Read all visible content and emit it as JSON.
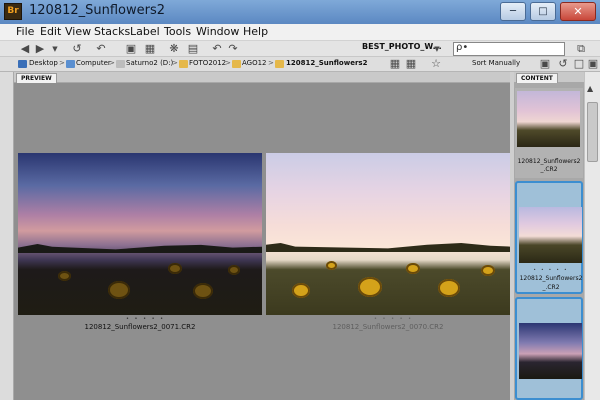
{
  "window": {
    "app_icon": "Br",
    "title": "120812_Sunflowers2",
    "min_icon": "minimize-icon",
    "max_icon": "maximize-icon",
    "close_icon": "close-icon"
  },
  "menu": [
    "File",
    "Edit",
    "View",
    "Stacks",
    "Label",
    "Tools",
    "Window",
    "Help"
  ],
  "toolbar": {
    "workspace_label": "BEST_PHOTO_W...",
    "search_placeholder": "ρ•"
  },
  "path": {
    "crumbs": [
      {
        "label": "Desktop",
        "icon": "desktop-icon"
      },
      {
        "label": "Computer",
        "icon": "computer-icon"
      },
      {
        "label": "Saturno2 (D:)",
        "icon": "drive-icon"
      },
      {
        "label": "FOTO2012",
        "icon": "folder-icon"
      },
      {
        "label": "AGO12",
        "icon": "folder-icon"
      },
      {
        "label": "120812_Sunflowers2",
        "icon": "folder-icon"
      }
    ],
    "sort_label": "Sort Manually"
  },
  "panels": {
    "preview_tab": "PREVIEW",
    "content_tab": "CONTENT"
  },
  "preview": {
    "images": [
      {
        "filename": "120812_Sunflowers2_0071.CR2",
        "rating": "• • • • •"
      },
      {
        "filename": "120812_Sunflowers2_0070.CR2",
        "rating": "• • • • •"
      }
    ]
  },
  "content": {
    "items": [
      {
        "name_line1": "120812_Sunflowers2",
        "name_line2": "_.CR2",
        "rating": "• • • • •"
      },
      {
        "name_line1": "120812_Sunflowers2",
        "name_line2": "_.CR2",
        "rating": "• • • • •"
      },
      {
        "name_line1": "",
        "name_line2": "",
        "rating": ""
      }
    ]
  },
  "colors": {
    "titlebar": "#5b88c2",
    "selection_border": "#3c8ed0",
    "preview_bg": "#8f8f8f"
  }
}
